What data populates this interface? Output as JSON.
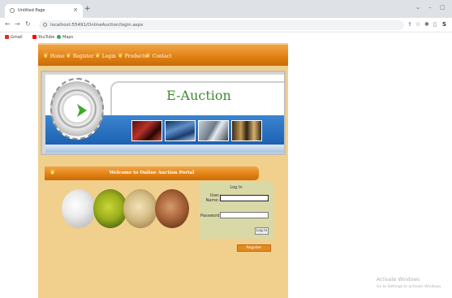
{
  "browser": {
    "tab_title": "Untitled Page",
    "tab_close": "×",
    "new_tab": "+",
    "url": "localhost:55491/OnlineAuction/login.aspx",
    "bookmarks": [
      "Gmail",
      "YouTube",
      "Maps"
    ],
    "window_controls": {
      "collapse": "⌄",
      "minimize": "–",
      "restore": "▢"
    }
  },
  "site": {
    "menu": [
      "Home",
      "Register",
      "Login",
      "Products",
      "Contact"
    ],
    "title": "E-Auction",
    "welcome": "Welcome to Online Auction Portal"
  },
  "login": {
    "title": "Log In",
    "username_label": "User Name:",
    "password_label": "Password:",
    "username_value": "",
    "password_value": "",
    "login_button": "Log In",
    "register_button": "Register"
  },
  "watermark": {
    "line1": "Activate Windows",
    "line2": "Go to Settings to activate Windows."
  },
  "colors": {
    "orange": "#e07f10",
    "page_bg": "#f1cf8c",
    "title_green": "#3b8a2e",
    "banner_blue": "#1d62b2"
  }
}
